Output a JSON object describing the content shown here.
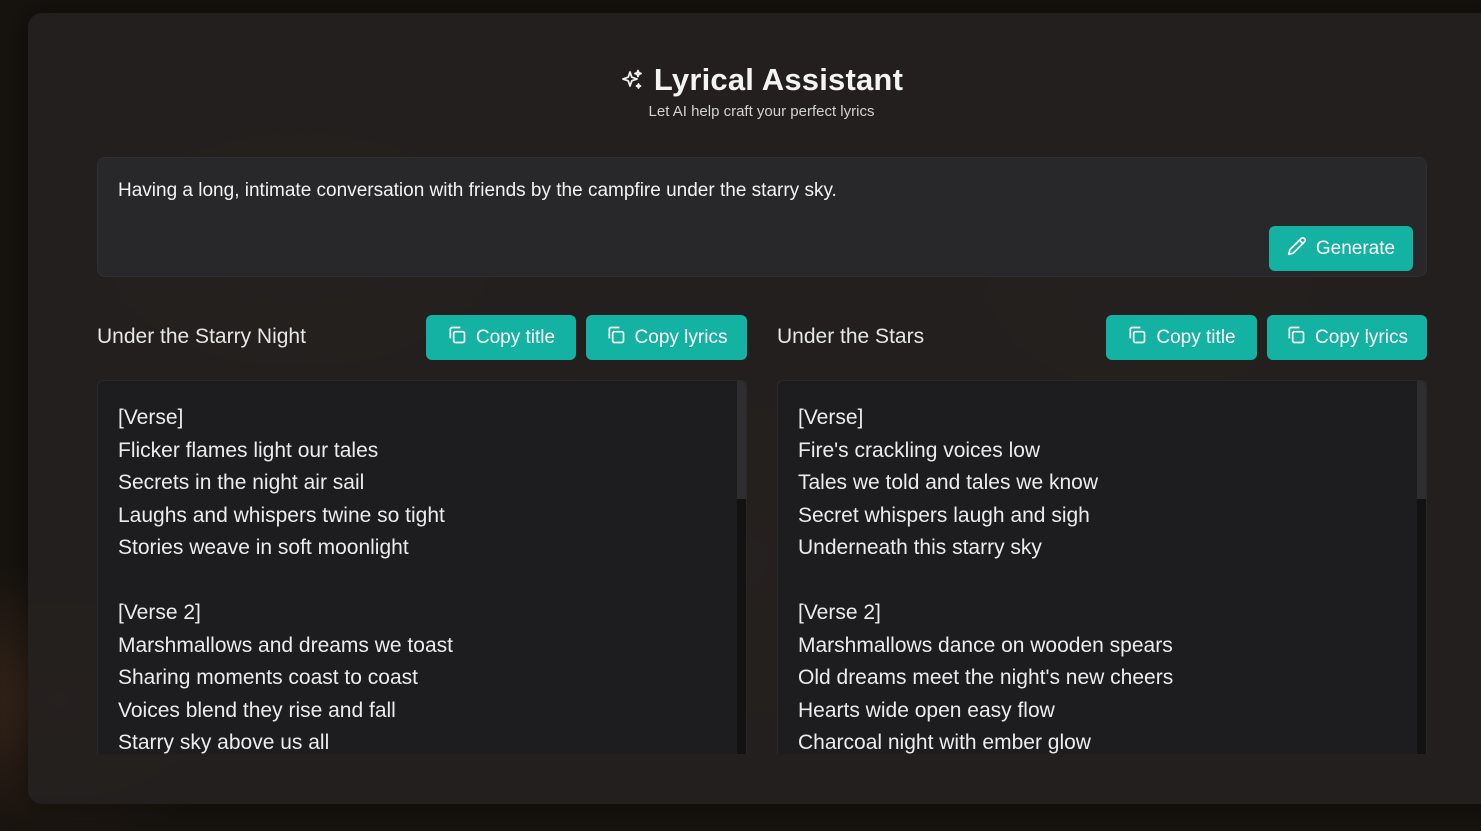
{
  "app": {
    "title": "Lyrical Assistant",
    "subtitle": "Let AI help craft your perfect lyrics",
    "title_icon": "sparkles-icon",
    "accent_color": "#14b2a3"
  },
  "prompt": {
    "value": "Having a long, intimate conversation with friends by the campfire under the starry sky.",
    "generate_label": "Generate",
    "generate_icon": "pencil-icon"
  },
  "results": [
    {
      "title": "Under the Starry Night",
      "copy_title_label": "Copy title",
      "copy_lyrics_label": "Copy lyrics",
      "copy_icon": "copy-icon",
      "lines": [
        "[Verse]",
        "Flicker flames light our tales",
        "Secrets in the night air sail",
        "Laughs and whispers twine so tight",
        "Stories weave in soft moonlight",
        "",
        "[Verse 2]",
        "Marshmallows and dreams we toast",
        "Sharing moments coast to coast",
        "Voices blend they rise and fall",
        "Starry sky above us all"
      ]
    },
    {
      "title": "Under the Stars",
      "copy_title_label": "Copy title",
      "copy_lyrics_label": "Copy lyrics",
      "copy_icon": "copy-icon",
      "lines": [
        "[Verse]",
        "Fire's crackling voices low",
        "Tales we told and tales we know",
        "Secret whispers laugh and sigh",
        "Underneath this starry sky",
        "",
        "[Verse 2]",
        "Marshmallows dance on wooden spears",
        "Old dreams meet the night's new cheers",
        "Hearts wide open easy flow",
        "Charcoal night with ember glow"
      ]
    }
  ]
}
